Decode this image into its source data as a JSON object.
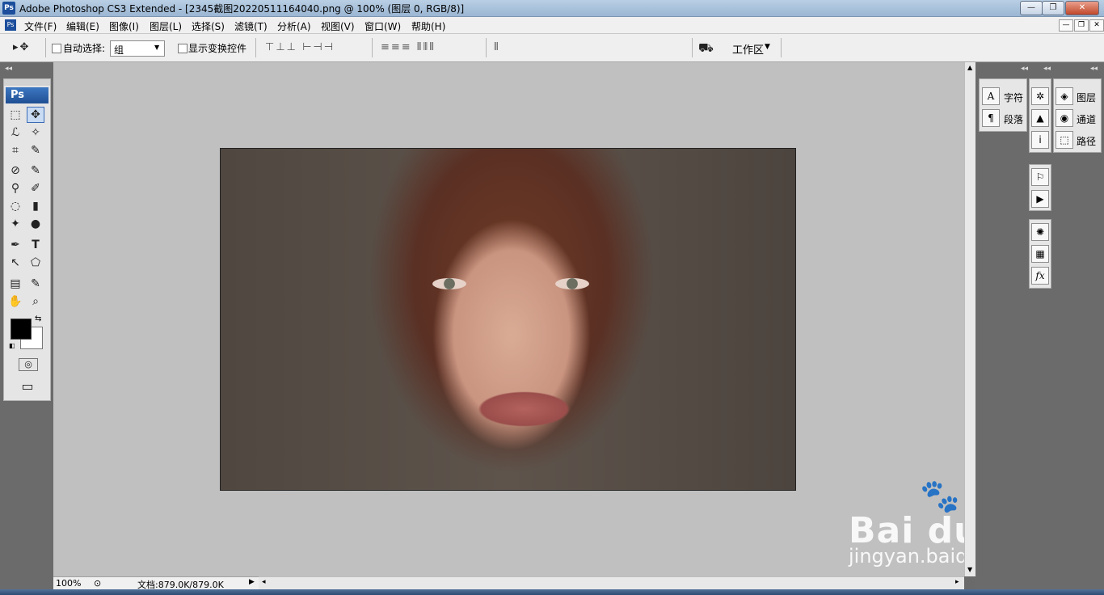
{
  "title_bar": {
    "title": "Adobe Photoshop CS3 Extended - [2345截图20220511164040.png @ 100% (图层 0, RGB/8)]",
    "logo": "Ps",
    "buttons": {
      "minimize": "—",
      "restore": "❐",
      "close": "✕"
    }
  },
  "menu_bar": {
    "logo": "Ps",
    "items": [
      "文件(F)",
      "编辑(E)",
      "图像(I)",
      "图层(L)",
      "选择(S)",
      "滤镜(T)",
      "分析(A)",
      "视图(V)",
      "窗口(W)",
      "帮助(H)"
    ],
    "doc_buttons": {
      "minimize": "—",
      "restore": "❐",
      "close": "✕"
    }
  },
  "options_bar": {
    "tool_glyph": "▸✥",
    "auto_select_label": "自动选择:",
    "auto_select_value": "组",
    "show_transform_label": "显示变换控件",
    "workspace_label": "工作区",
    "workspace_arrow": "▼"
  },
  "toolbox": {
    "logo": "Ps",
    "collapse_glyph": "◂◂",
    "tools": [
      [
        "⬚",
        "✥"
      ],
      [
        "ℒ",
        "✧"
      ],
      [
        "⌗",
        "✎"
      ],
      [
        "⊘",
        "✎"
      ],
      [
        "⚲",
        "✐"
      ],
      [
        "◌",
        "▮"
      ],
      [
        "✦",
        "●"
      ],
      [
        "✒",
        "T"
      ],
      [
        "↖",
        "⬠"
      ],
      [
        "▤",
        "✎"
      ],
      [
        "✋",
        "⌕"
      ]
    ],
    "mask_glyph": "◎",
    "screen_glyph": "▭"
  },
  "status_bar": {
    "zoom": "100%",
    "doc_info": "文档:879.0K/879.0K"
  },
  "right_panels": {
    "collapse_glyph": "◂◂",
    "group1": [
      {
        "icon": "A",
        "label": "字符"
      },
      {
        "icon": "¶",
        "label": "段落"
      }
    ],
    "group2_icons": [
      "✲",
      "▲",
      "ⅰ",
      "⚐",
      "▶",
      "✺",
      "▦",
      "fx"
    ],
    "group3": [
      {
        "icon": "◈",
        "label": "图层"
      },
      {
        "icon": "◉",
        "label": "通道"
      },
      {
        "icon": "⬚",
        "label": "路径"
      }
    ]
  },
  "watermark": {
    "brand": "Bai du 经验",
    "url": "jingyan.baidu.com"
  },
  "colors": {
    "accent": "#1f4f93",
    "canvas_bg": "#c0c0c0",
    "panel_bg": "#e6e6e6",
    "foreground_swatch": "#000000",
    "background_swatch": "#ffffff"
  }
}
